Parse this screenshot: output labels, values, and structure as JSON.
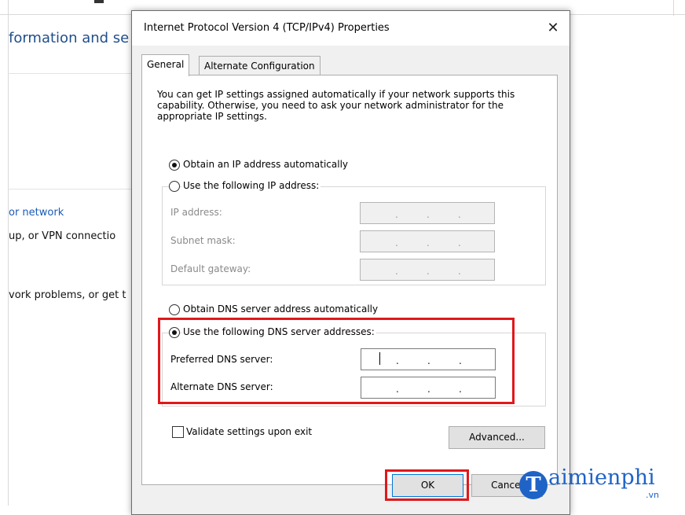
{
  "background": {
    "heading": "formation and se",
    "link": "or network",
    "line1": "up, or VPN connectio",
    "line2": "vork problems, or get t"
  },
  "dialog": {
    "title": "Internet Protocol Version 4 (TCP/IPv4) Properties",
    "close_glyph": "✕",
    "tabs": [
      "General",
      "Alternate Configuration"
    ],
    "description": "You can get IP settings assigned automatically if your network supports this capability. Otherwise, you need to ask your network administrator for the appropriate IP settings.",
    "ip_auto_label": "Obtain an IP address automatically",
    "ip_manual_label": "Use the following IP address:",
    "ip_address_label": "IP address:",
    "subnet_mask_label": "Subnet mask:",
    "default_gateway_label": "Default gateway:",
    "dns_auto_label": "Obtain DNS server address automatically",
    "dns_manual_label": "Use the following DNS server addresses:",
    "preferred_dns_label": "Preferred DNS server:",
    "alternate_dns_label": "Alternate DNS server:",
    "validate_label": "Validate settings upon exit",
    "advanced_label": "Advanced...",
    "ok_label": "OK",
    "cancel_label": "Cancel",
    "ip_selected": "auto",
    "dns_selected": "manual",
    "validate_checked": false
  },
  "watermark": {
    "brand_initial": "T",
    "brand_rest": "aimienphi",
    "suffix": ".vn"
  },
  "colors": {
    "highlight": "#e0181b",
    "brand": "#1f63c6"
  }
}
